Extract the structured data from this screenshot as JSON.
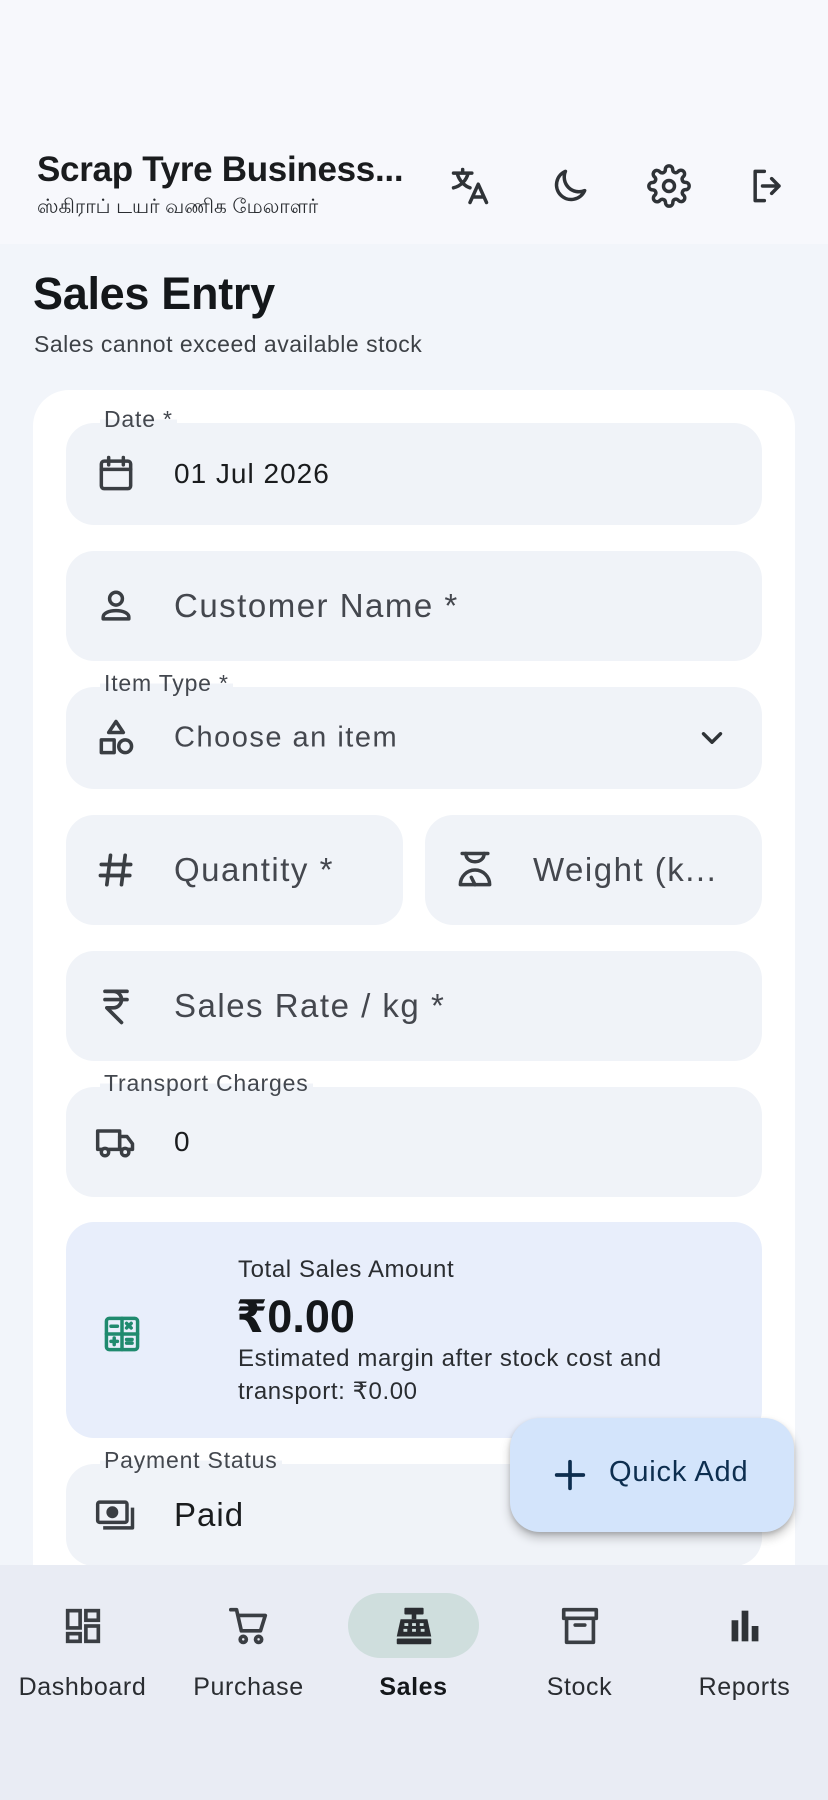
{
  "header": {
    "title": "Scrap Tyre Business...",
    "subtitle": "ஸ்கிராப் டயர் வணிக மேலாளர்",
    "actions": [
      "translate-icon",
      "dark-mode-icon",
      "settings-icon",
      "logout-icon"
    ]
  },
  "page": {
    "title": "Sales Entry",
    "subtitle": "Sales cannot exceed available stock"
  },
  "form": {
    "date": {
      "label": "Date *",
      "value": "01 Jul 2026",
      "icon": "calendar-icon"
    },
    "customer": {
      "placeholder": "Customer Name *",
      "icon": "person-icon"
    },
    "item_type": {
      "label": "Item Type *",
      "value": "Choose an item",
      "icon": "category-icon"
    },
    "quantity": {
      "placeholder": "Quantity *",
      "icon": "hash-icon"
    },
    "weight": {
      "placeholder": "Weight (k...",
      "icon": "scale-icon"
    },
    "sales_rate": {
      "placeholder": "Sales Rate / kg *",
      "icon": "rupee-icon"
    },
    "transport": {
      "label": "Transport Charges",
      "value": "0",
      "icon": "truck-icon"
    },
    "payment": {
      "label": "Payment Status",
      "value": "Paid",
      "icon": "payments-icon"
    }
  },
  "summary": {
    "label": "Total Sales Amount",
    "amount": "₹0.00",
    "note": "Estimated margin after stock cost and transport: ₹0.00"
  },
  "fab": {
    "label": "Quick Add"
  },
  "nav": {
    "items": [
      {
        "label": "Dashboard",
        "icon": "dashboard-icon",
        "active": false
      },
      {
        "label": "Purchase",
        "icon": "cart-icon",
        "active": false
      },
      {
        "label": "Sales",
        "icon": "cash-register-icon",
        "active": true
      },
      {
        "label": "Stock",
        "icon": "archive-box-icon",
        "active": false
      },
      {
        "label": "Reports",
        "icon": "bar-chart-icon",
        "active": false
      }
    ]
  },
  "colors": {
    "background": "#f2f5fa",
    "card": "#ffffff",
    "field": "#f0f3f8",
    "summary": "#e8eefb",
    "fab": "#d3e4fb",
    "nav_active_pill": "#cfdedd",
    "calculator_icon": "#1f8a6e"
  }
}
